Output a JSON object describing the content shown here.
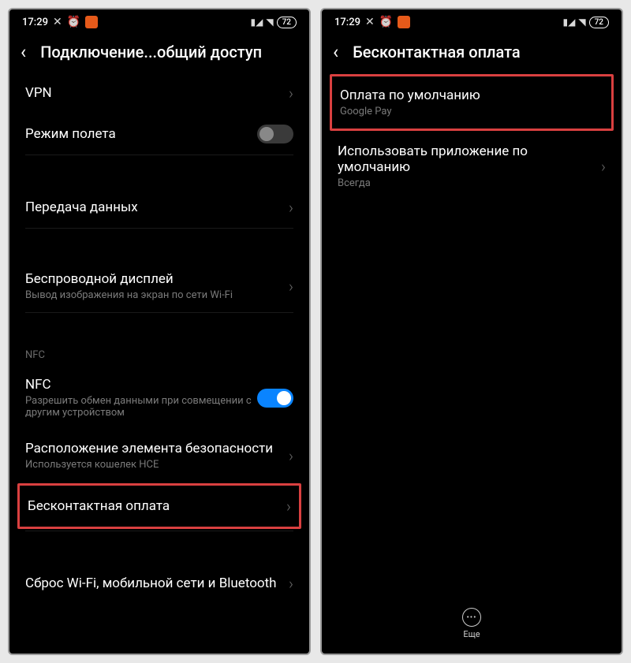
{
  "statusbar": {
    "time": "17:29",
    "battery": "72"
  },
  "screen1": {
    "title": "Подключение...общий доступ",
    "items": {
      "vpn": {
        "title": "VPN"
      },
      "airplane": {
        "title": "Режим полета"
      },
      "data": {
        "title": "Передача данных"
      },
      "wireless": {
        "title": "Беспроводной дисплей",
        "sub": "Вывод изображения на экран по сети Wi-Fi"
      },
      "nfcSection": "NFC",
      "nfc": {
        "title": "NFC",
        "sub": "Разрешить обмен данными при совмещении с другим устройством"
      },
      "secure": {
        "title": "Расположение элемента безопасности",
        "sub": "Используется кошелек HCE"
      },
      "contactless": {
        "title": "Бесконтактная оплата"
      },
      "reset": {
        "title": "Сброс Wi-Fi, мобильной сети и Bluetooth"
      }
    }
  },
  "screen2": {
    "title": "Бесконтактная оплата",
    "items": {
      "default": {
        "title": "Оплата по умолчанию",
        "sub": "Google Pay"
      },
      "useApp": {
        "title": "Использовать приложение по умолчанию",
        "sub": "Всегда"
      }
    },
    "more": "Еще"
  }
}
